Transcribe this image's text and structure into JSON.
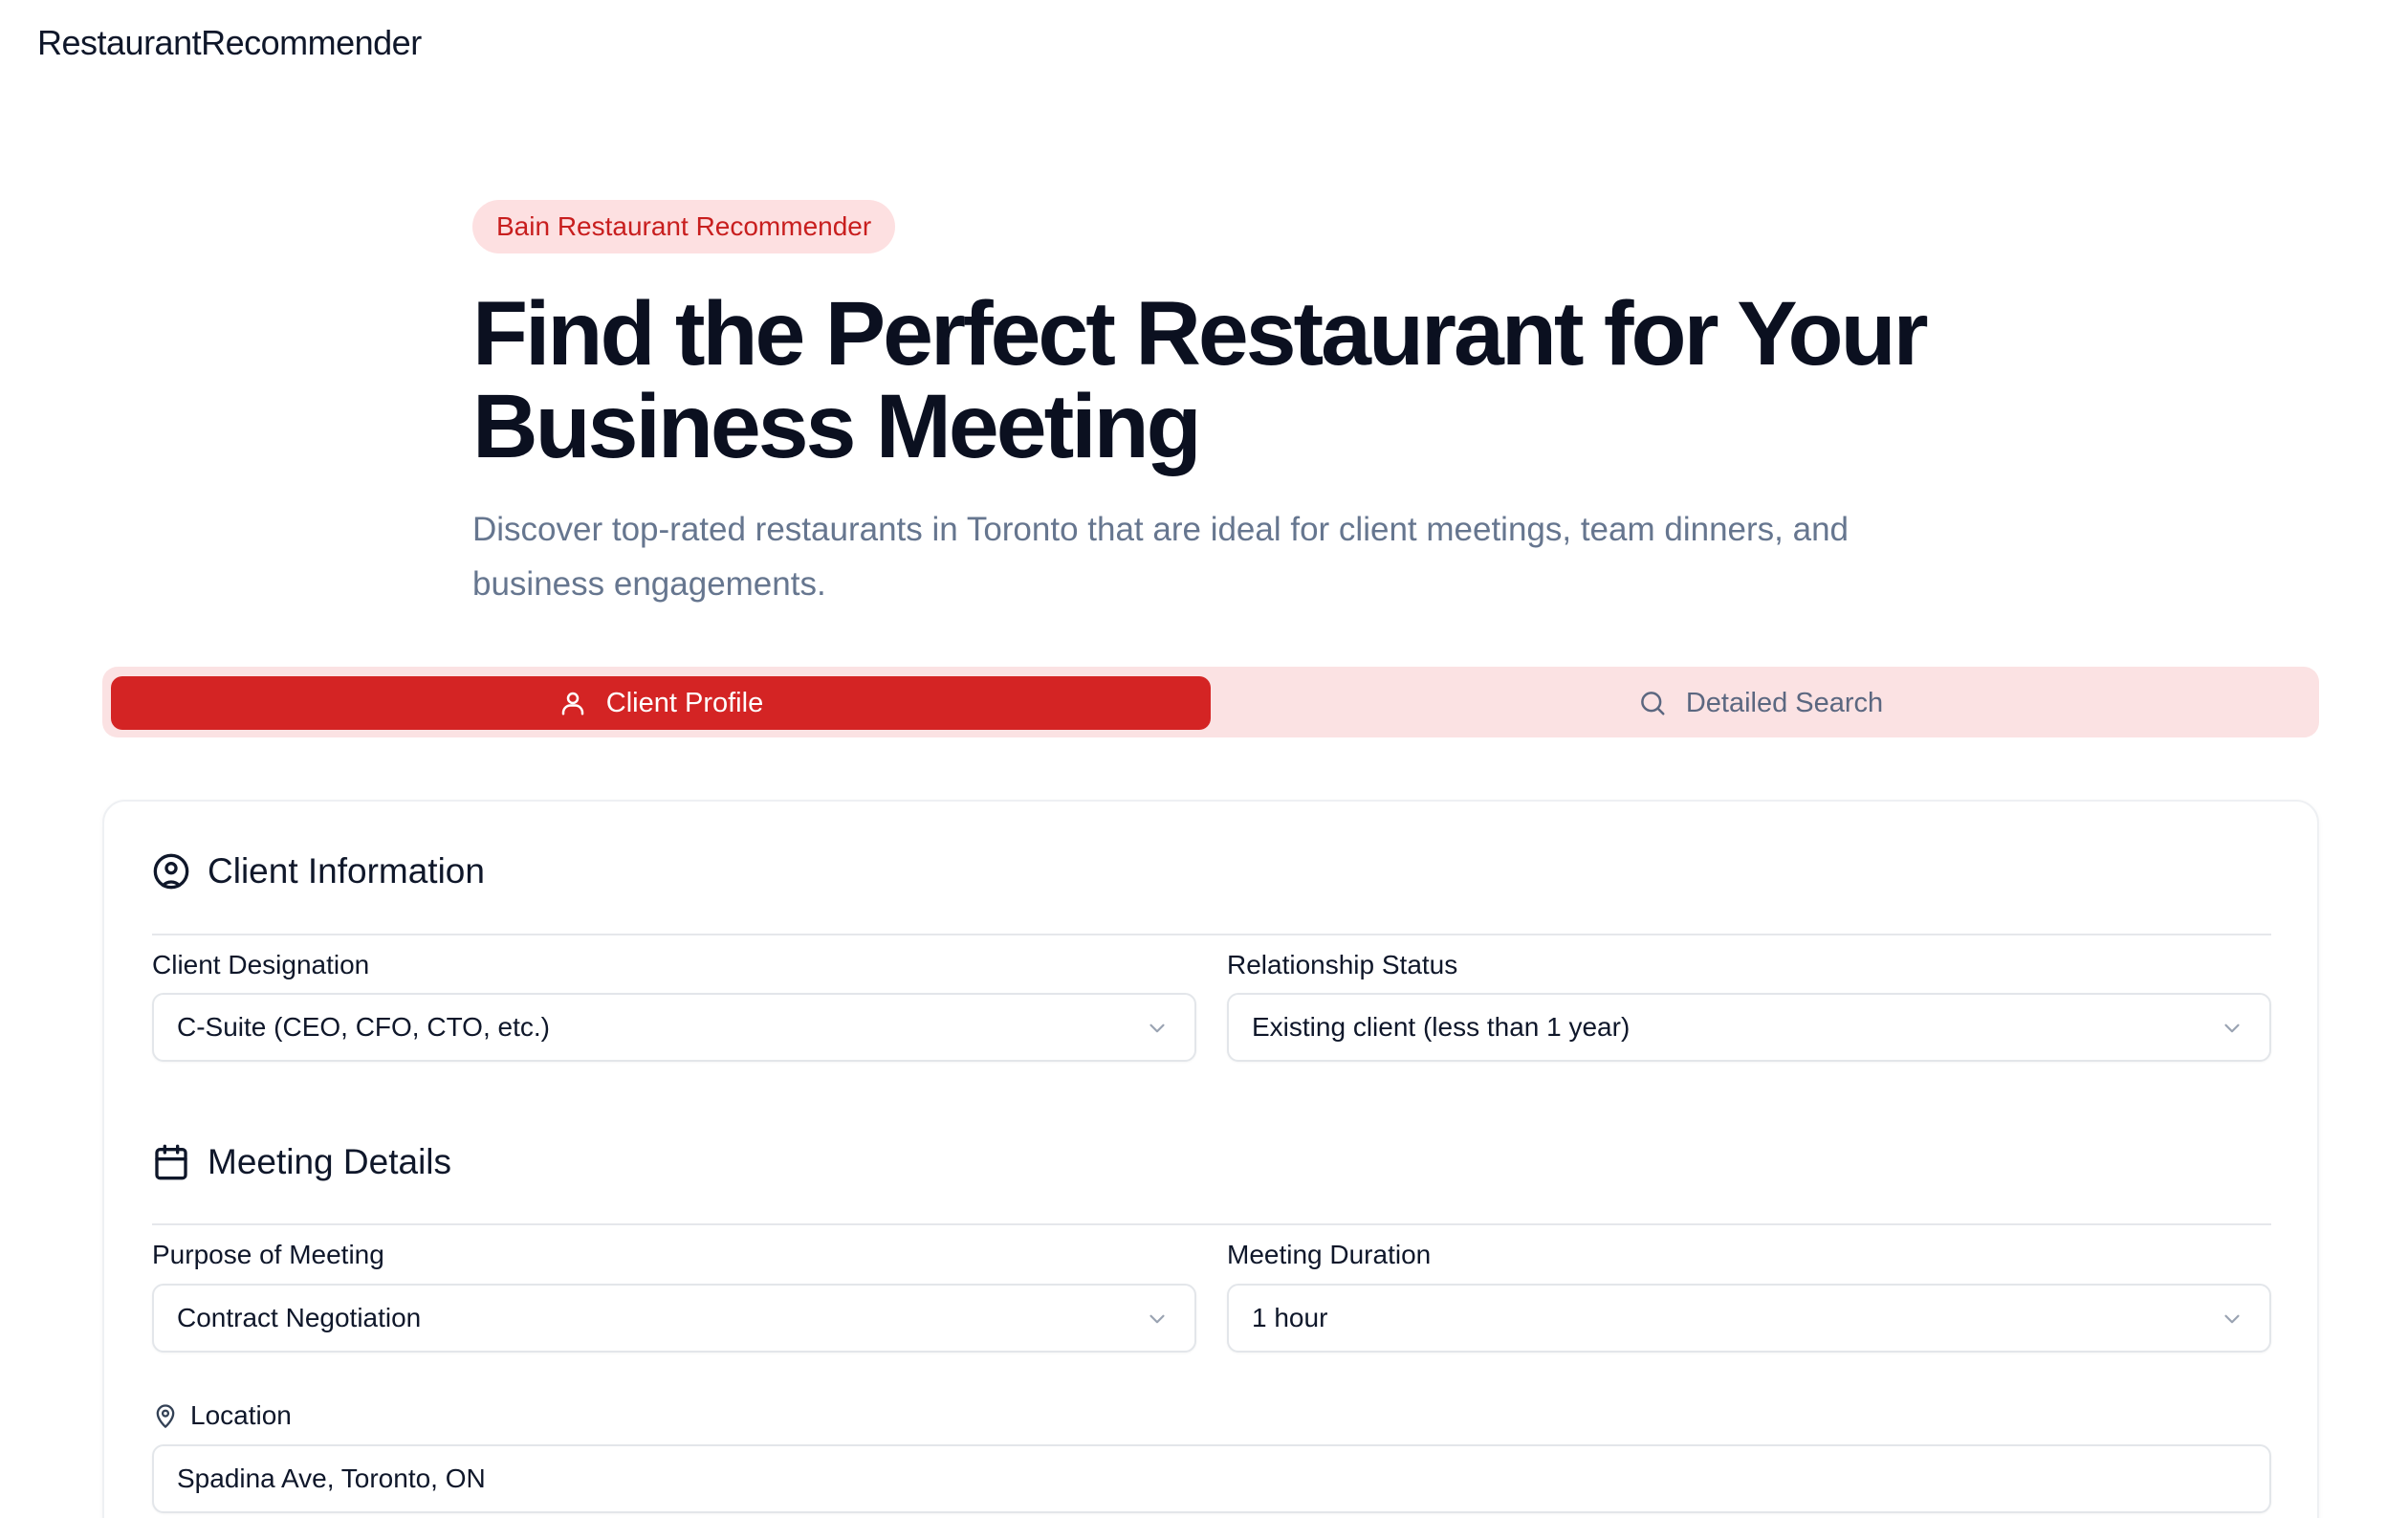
{
  "app": {
    "brand": "RestaurantRecommender"
  },
  "hero": {
    "badge": "Bain Restaurant Recommender",
    "title_line1": "Find the Perfect Restaurant for Your",
    "title_line2": "Business Meeting",
    "subtitle": "Discover top-rated restaurants in Toronto that are ideal for client meetings, team dinners, and business engagements."
  },
  "tabs": [
    {
      "label": "Client Profile",
      "icon": "user-icon",
      "active": true
    },
    {
      "label": "Detailed Search",
      "icon": "search-icon",
      "active": false
    }
  ],
  "client_info": {
    "heading": "Client Information",
    "designation_label": "Client Designation",
    "designation_value": "C-Suite (CEO, CFO, CTO, etc.)",
    "relationship_label": "Relationship Status",
    "relationship_value": "Existing client (less than 1 year)"
  },
  "meeting": {
    "heading": "Meeting Details",
    "purpose_label": "Purpose of Meeting",
    "purpose_value": "Contract Negotiation",
    "duration_label": "Meeting Duration",
    "duration_value": "1 hour",
    "location_label": "Location",
    "location_value": "Spadina Ave, Toronto, ON"
  },
  "colors": {
    "accent": "#d42424",
    "accent_soft": "#fbe2e3",
    "text": "#0f172a",
    "muted": "#66768f"
  }
}
